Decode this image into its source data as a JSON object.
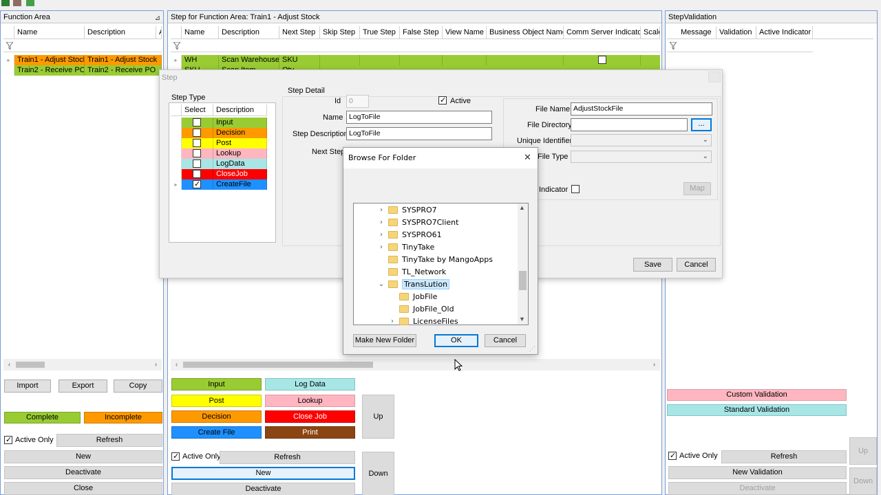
{
  "function_area": {
    "title": "Function Area",
    "columns": [
      "Name",
      "Description",
      "A"
    ],
    "rows": [
      {
        "name": "Train1 - Adjust Stock",
        "description": "Train1 - Adjust Stock",
        "color": "#ff9900"
      },
      {
        "name": "Train2 - Receive PO",
        "description": "Train2 - Receive PO",
        "color": "#99cc33"
      }
    ],
    "buttons": {
      "import": "Import",
      "export": "Export",
      "copy": "Copy",
      "complete": "Complete",
      "incomplete": "Incomplete",
      "active_only": "Active Only",
      "refresh": "Refresh",
      "new": "New",
      "deactivate": "Deactivate",
      "close": "Close"
    }
  },
  "step_panel": {
    "title": "Step for Function Area:  Train1 - Adjust Stock",
    "columns": [
      "Name",
      "Description",
      "Next Step",
      "Skip Step",
      "True Step",
      "False Step",
      "View Name",
      "Business Object Name",
      "Comm Server Indicator",
      "Scale"
    ],
    "rows": [
      {
        "name": "WH",
        "description": "Scan Warehouse",
        "next": "SKU"
      },
      {
        "name": "SKU",
        "description": "Scan Item",
        "next": "Qty"
      }
    ],
    "buttons": {
      "input": "Input",
      "log_data": "Log Data",
      "post": "Post",
      "lookup": "Lookup",
      "decision": "Decision",
      "close_job": "Close Job",
      "create_file": "Create File",
      "print": "Print",
      "up": "Up",
      "down": "Down",
      "active_only": "Active Only",
      "refresh": "Refresh",
      "new": "New",
      "deactivate": "Deactivate"
    }
  },
  "validation_panel": {
    "title": "StepValidation",
    "columns": [
      "Message",
      "Validation",
      "Active Indicator"
    ],
    "buttons": {
      "custom": "Custom Validation",
      "standard": "Standard Validation",
      "active_only": "Active Only",
      "refresh": "Refresh",
      "new": "New Validation",
      "deactivate": "Deactivate",
      "up": "Up",
      "down": "Down"
    }
  },
  "step_dialog": {
    "title": "Step",
    "step_type_label": "Step Type",
    "step_type_columns": [
      "Select",
      "Description"
    ],
    "step_types": [
      {
        "label": "Input",
        "color": "#99cc33",
        "checked": false
      },
      {
        "label": "Decision",
        "color": "#ff9900",
        "checked": false
      },
      {
        "label": "Post",
        "color": "#ffff00",
        "checked": false
      },
      {
        "label": "Lookup",
        "color": "#ffb6c1",
        "checked": false
      },
      {
        "label": "LogData",
        "color": "#a8e6e6",
        "checked": false
      },
      {
        "label": "CloseJob",
        "color": "#ff0000",
        "checked": false
      },
      {
        "label": "CreateFile",
        "color": "#1e90ff",
        "checked": true
      }
    ],
    "step_detail_label": "Step Detail",
    "id_label": "Id",
    "id_value": "0",
    "active_label": "Active",
    "name_label": "Name",
    "name_value": "LogToFile",
    "step_desc_label": "Step Description",
    "step_desc_value": "LogToFile",
    "next_step_label": "Next Step",
    "file_name_label": "File Name",
    "file_name_value": "AdjustStockFile",
    "file_dir_label": "File Directory",
    "browse_label": "...",
    "unique_id_label": "Unique Identifier",
    "file_type_label": "File Type",
    "indicator_label": "Indicator",
    "map_label": "Map",
    "save_label": "Save",
    "cancel_label": "Cancel"
  },
  "browse_dialog": {
    "title": "Browse For Folder",
    "close": "✕",
    "folders": [
      {
        "label": "SYSPRO7",
        "toggle": "›",
        "level": 0,
        "selected": false
      },
      {
        "label": "SYSPRO7Client",
        "toggle": "›",
        "level": 0,
        "selected": false
      },
      {
        "label": "SYSPRO61",
        "toggle": "›",
        "level": 0,
        "selected": false
      },
      {
        "label": "TinyTake",
        "toggle": "›",
        "level": 0,
        "selected": false
      },
      {
        "label": "TinyTake by MangoApps",
        "toggle": "",
        "level": 0,
        "selected": false
      },
      {
        "label": "TL_Network",
        "toggle": "",
        "level": 0,
        "selected": false
      },
      {
        "label": "TransLution",
        "toggle": "⌄",
        "level": 0,
        "selected": true
      },
      {
        "label": "JobFile",
        "toggle": "",
        "level": 1,
        "selected": false
      },
      {
        "label": "JobFile_Old",
        "toggle": "",
        "level": 1,
        "selected": false
      },
      {
        "label": "LicenseFiles",
        "toggle": "›",
        "level": 1,
        "selected": false
      }
    ],
    "make_new_folder": "Make New Folder",
    "ok": "OK",
    "cancel": "Cancel"
  }
}
